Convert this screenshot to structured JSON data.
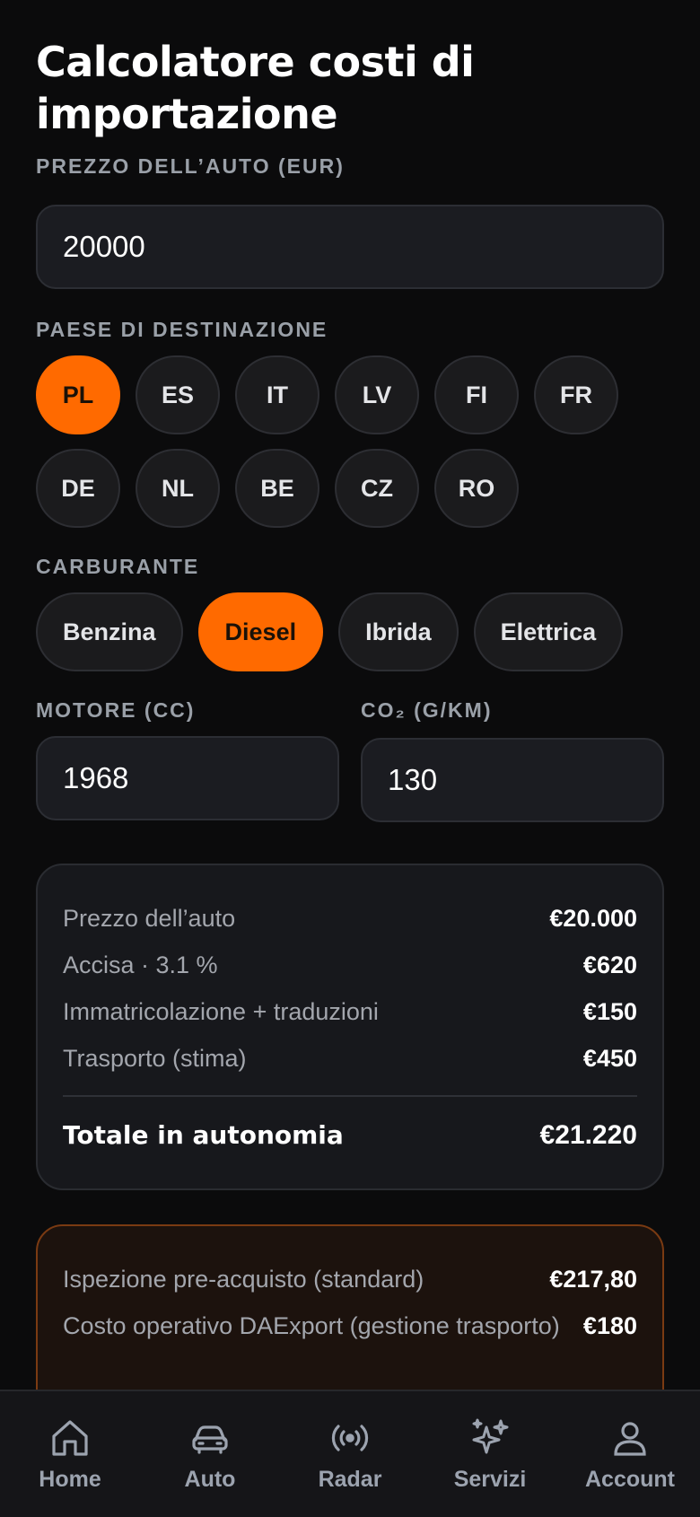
{
  "page": {
    "title": "Calcolatore costi di importazione"
  },
  "form": {
    "price_label": "PREZZO DELL’AUTO (EUR)",
    "price_value": "20000",
    "country_label": "PAESE DI DESTINAZIONE",
    "countries": [
      "PL",
      "ES",
      "IT",
      "LV",
      "FI",
      "FR",
      "DE",
      "NL",
      "BE",
      "CZ",
      "RO"
    ],
    "selected_country": "PL",
    "fuel_label": "CARBURANTE",
    "fuels": [
      "Benzina",
      "Diesel",
      "Ibrida",
      "Elettrica"
    ],
    "selected_fuel": "Diesel",
    "engine_label": "MOTORE (CC)",
    "engine_value": "1968",
    "co2_label": "CO₂ (G/KM)",
    "co2_value": "130"
  },
  "summary": {
    "rows": [
      {
        "label": "Prezzo dell’auto",
        "value": "€20.000"
      },
      {
        "label": "Accisa · 3.1 %",
        "value": "€620"
      },
      {
        "label": "Immatricolazione + traduzioni",
        "value": "€150"
      },
      {
        "label": "Trasporto (stima)",
        "value": "€450"
      }
    ],
    "total_label": "Totale in autonomia",
    "total_value": "€21.220"
  },
  "service": {
    "rows": [
      {
        "label": "Ispezione pre-acquisto (standard)",
        "value": "€217,80"
      },
      {
        "label": "Costo operativo DAExport (gestione trasporto)",
        "value": "€180"
      }
    ]
  },
  "nav": {
    "items": [
      {
        "label": "Home",
        "icon": "home-icon"
      },
      {
        "label": "Auto",
        "icon": "car-icon"
      },
      {
        "label": "Radar",
        "icon": "radar-icon"
      },
      {
        "label": "Servizi",
        "icon": "sparkles-icon"
      },
      {
        "label": "Account",
        "icon": "user-icon"
      }
    ]
  },
  "colors": {
    "accent": "#ff6a00",
    "background": "#0b0b0c",
    "card": "#17181c"
  }
}
